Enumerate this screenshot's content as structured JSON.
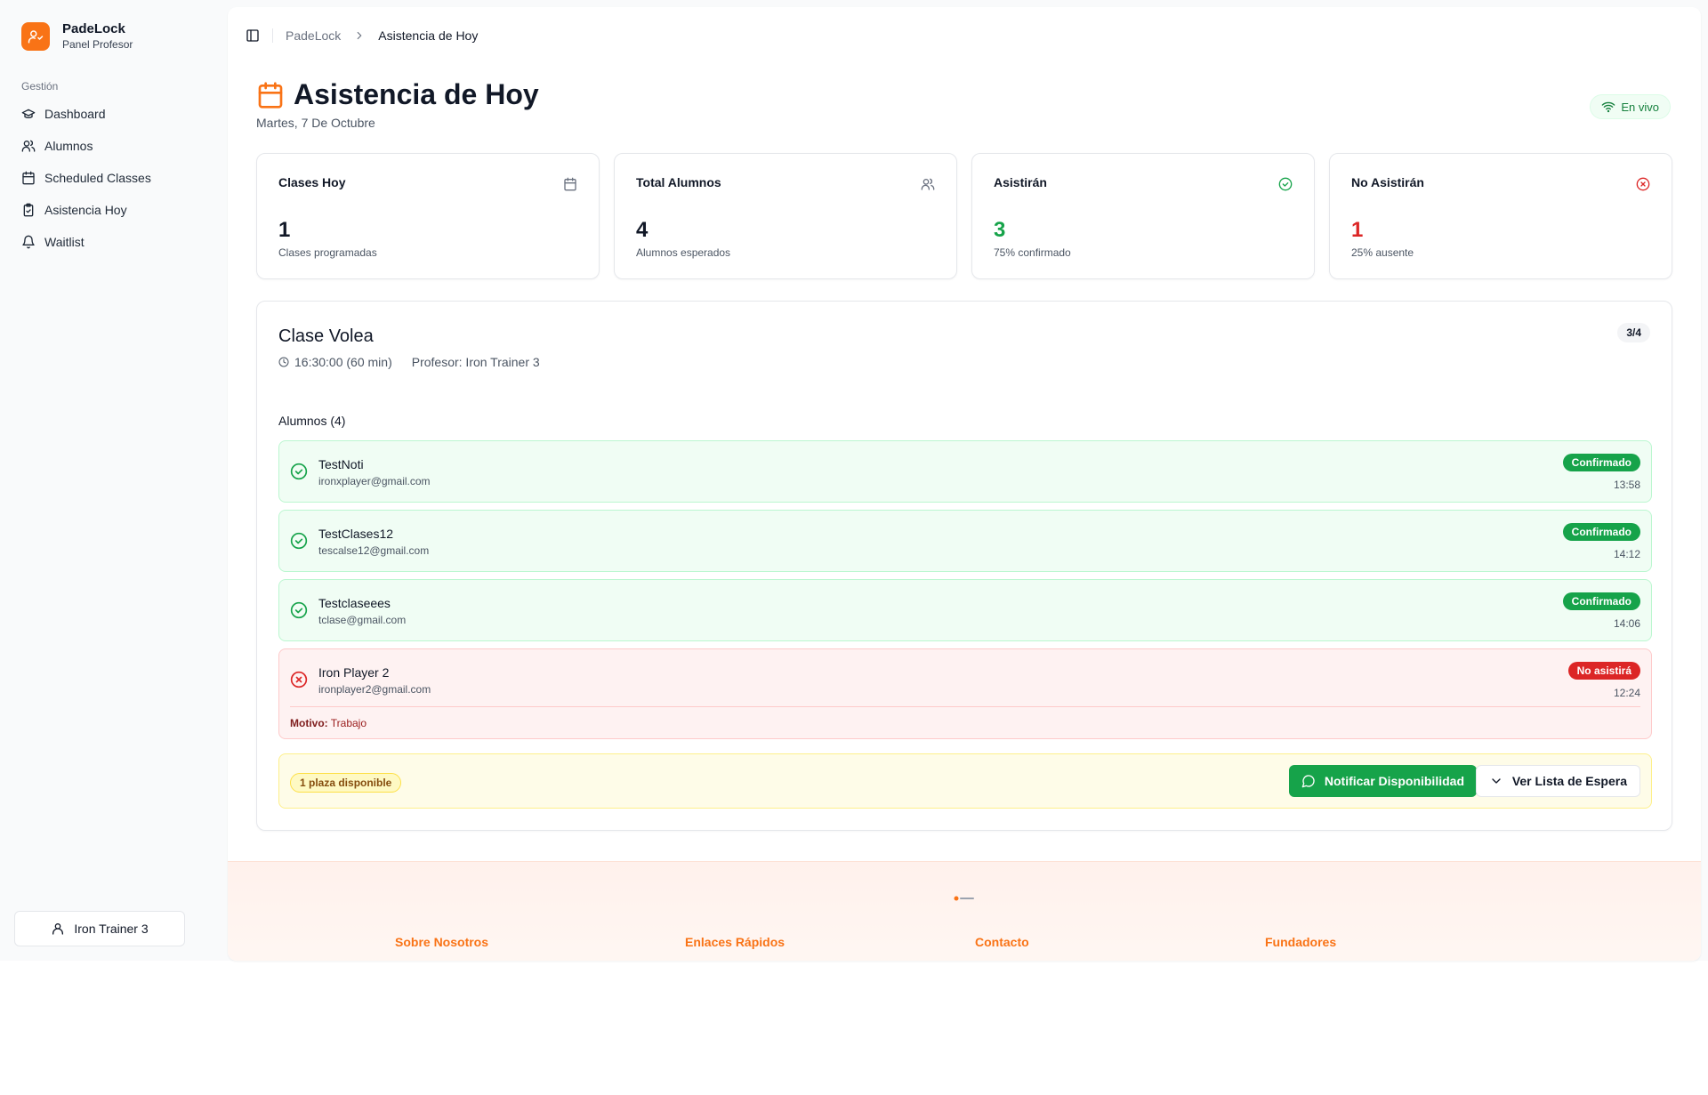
{
  "brand": {
    "name": "PadeLock",
    "subtitle": "Panel Profesor"
  },
  "sidebar": {
    "group_label": "Gestión",
    "items": [
      {
        "label": "Dashboard",
        "icon": "graduation-cap-icon"
      },
      {
        "label": "Alumnos",
        "icon": "users-icon"
      },
      {
        "label": "Scheduled Classes",
        "icon": "calendar-icon"
      },
      {
        "label": "Asistencia Hoy",
        "icon": "clipboard-check-icon"
      },
      {
        "label": "Waitlist",
        "icon": "bell-icon"
      }
    ],
    "user_label": "Iron Trainer 3"
  },
  "breadcrumb": {
    "root": "PadeLock",
    "current": "Asistencia de Hoy"
  },
  "header": {
    "title": "Asistencia de Hoy",
    "date": "Martes, 7 De Octubre",
    "live_label": "En vivo"
  },
  "stats": [
    {
      "label": "Clases Hoy",
      "value": "1",
      "caption": "Clases programadas",
      "icon": "calendar-icon",
      "color": "#111827"
    },
    {
      "label": "Total Alumnos",
      "value": "4",
      "caption": "Alumnos esperados",
      "icon": "users-icon",
      "color": "#111827"
    },
    {
      "label": "Asistirán",
      "value": "3",
      "caption": "75% confirmado",
      "icon": "check-circle-icon",
      "color": "#16a34a"
    },
    {
      "label": "No Asistirán",
      "value": "1",
      "caption": "25% ausente",
      "icon": "x-circle-icon",
      "color": "#dc2626"
    }
  ],
  "class": {
    "title": "Clase Volea",
    "time": "16:30:00 (60 min)",
    "teacher": "Profesor: Iron Trainer 3",
    "count": "3/4",
    "students_label": "Alumnos (4)",
    "students": [
      {
        "name": "TestNoti",
        "email": "ironxplayer@gmail.com",
        "status": "Confirmado",
        "time": "13:58"
      },
      {
        "name": "TestClases12",
        "email": "tescalse12@gmail.com",
        "status": "Confirmado",
        "time": "14:12"
      },
      {
        "name": "Testclaseees",
        "email": "tclase@gmail.com",
        "status": "Confirmado",
        "time": "14:06"
      },
      {
        "name": "Iron Player 2",
        "email": "ironplayer2@gmail.com",
        "status": "No asistirá",
        "time": "12:24",
        "reason_label": "Motivo:",
        "reason": "Trabajo"
      }
    ],
    "available": "1 plaza disponible",
    "notify_label": "Notificar Disponibilidad",
    "waitlist_label": "Ver Lista de Espera"
  },
  "footer": {
    "columns": [
      "Sobre Nosotros",
      "Enlaces Rápidos",
      "Contacto",
      "Fundadores"
    ]
  }
}
